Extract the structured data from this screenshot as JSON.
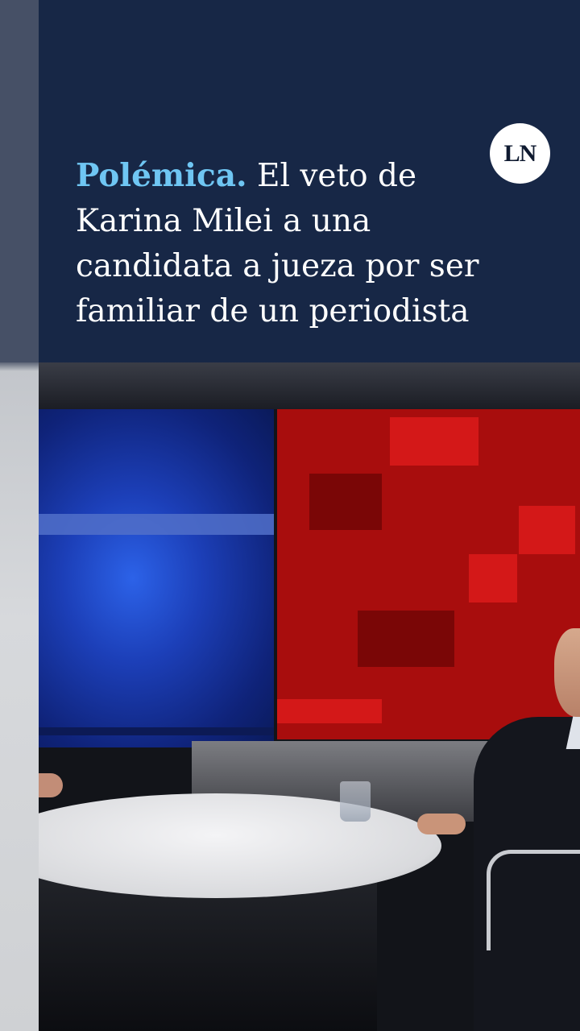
{
  "headline": {
    "kicker": "Polémica.",
    "text": " El veto de Karina Milei a una candidata a jueza por ser familiar de un periodista"
  },
  "logo": {
    "text": "LN"
  },
  "colors": {
    "panel_bg": "#172746",
    "kicker": "#6fc6f3",
    "headline_text": "#ffffff",
    "logo_bg": "#ffffff"
  },
  "video": {
    "description_icons": [
      "blue-studio-screen",
      "red-studio-screen",
      "studio-table",
      "water-glass",
      "guest"
    ]
  }
}
